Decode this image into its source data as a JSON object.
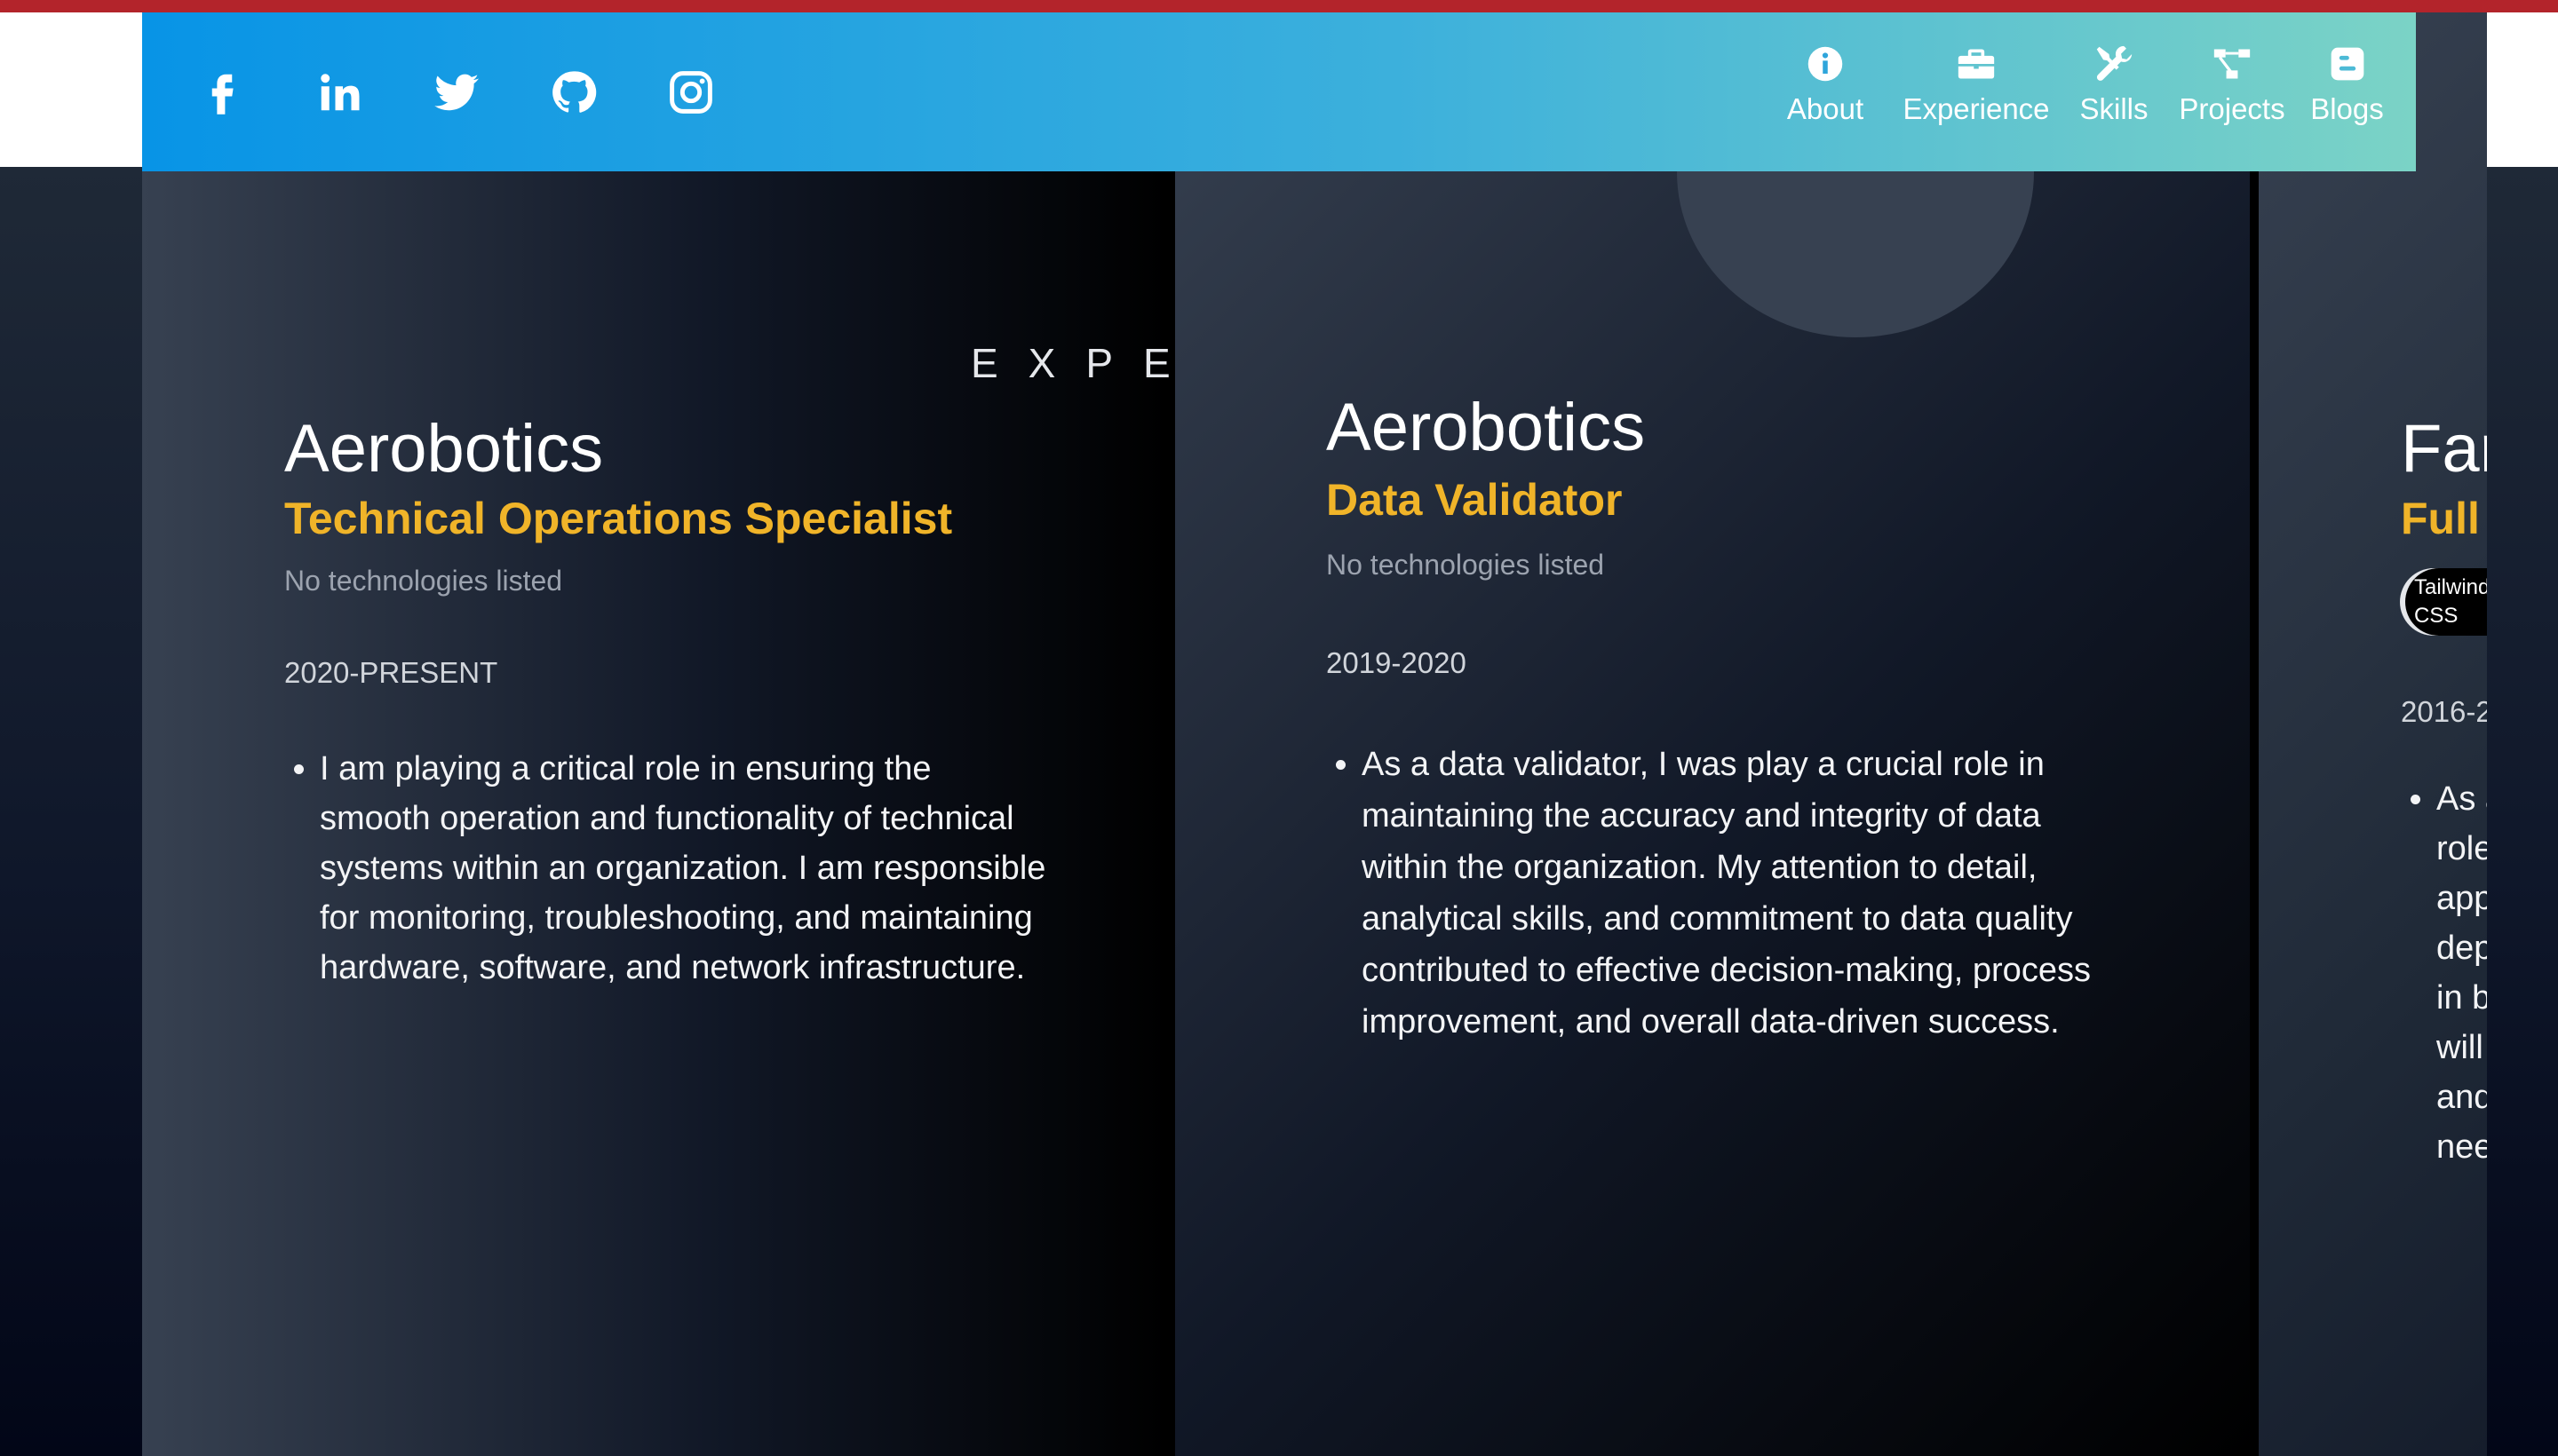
{
  "header": {
    "social_links": [
      {
        "icon": "facebook-icon"
      },
      {
        "icon": "linkedin-icon"
      },
      {
        "icon": "twitter-icon"
      },
      {
        "icon": "github-icon"
      },
      {
        "icon": "instagram-icon"
      }
    ],
    "nav": [
      {
        "label": "About",
        "icon": "info-icon"
      },
      {
        "label": "Experience",
        "icon": "briefcase-icon"
      },
      {
        "label": "Skills",
        "icon": "tools-icon"
      },
      {
        "label": "Projects",
        "icon": "project-diagram-icon"
      },
      {
        "label": "Blogs",
        "icon": "blogger-icon"
      }
    ]
  },
  "section": {
    "heading": "EXPE"
  },
  "experiences": [
    {
      "company": "Aerobotics",
      "role": "Technical Operations Specialist",
      "technologies": "No technologies listed",
      "period": "2020-PRESENT",
      "description": "I am playing a critical role in ensuring the smooth operation and functionality of technical systems within an organization. I am responsible for monitoring, troubleshooting, and maintaining hardware, software, and network infrastructure."
    },
    {
      "company": "Aerobotics",
      "role": "Data Validator",
      "technologies": "No technologies listed",
      "period": "2019-2020",
      "description": "As a data validator, I was play a crucial role in maintaining the accuracy and integrity of data within the organization. My attention to detail, analytical skills, and commitment to data quality contributed to effective decision-making, process improvement, and overall data-driven success."
    },
    {
      "company": "Far",
      "role": "Full",
      "tag": "Tailwind CSS",
      "period": "2016-2",
      "description": "As a role app dep in b will and nee"
    }
  ],
  "colors": {
    "accent_role": "#f0b429",
    "top_bar": "#b3242b",
    "nav_gradient_start": "#0894e6",
    "nav_gradient_end": "#7bd3c6"
  }
}
